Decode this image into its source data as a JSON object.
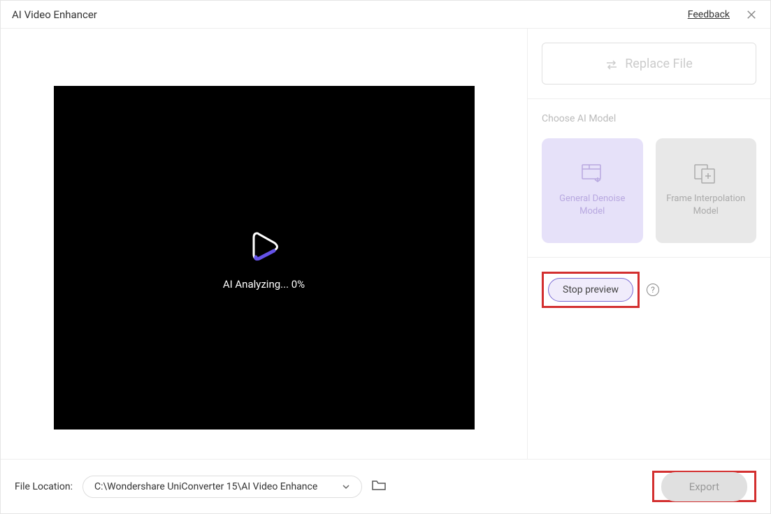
{
  "titlebar": {
    "title": "AI Video Enhancer",
    "feedback": "Feedback"
  },
  "video": {
    "status_text": "AI Analyzing... 0%"
  },
  "sidebar": {
    "replace_label": "Replace File",
    "model_label": "Choose AI Model",
    "models": [
      {
        "name": "General Denoise Model"
      },
      {
        "name": "Frame Interpolation Model"
      }
    ],
    "stop_preview": "Stop preview"
  },
  "footer": {
    "location_label": "File Location:",
    "path": "C:\\Wondershare UniConverter 15\\AI Video Enhance",
    "export": "Export"
  }
}
